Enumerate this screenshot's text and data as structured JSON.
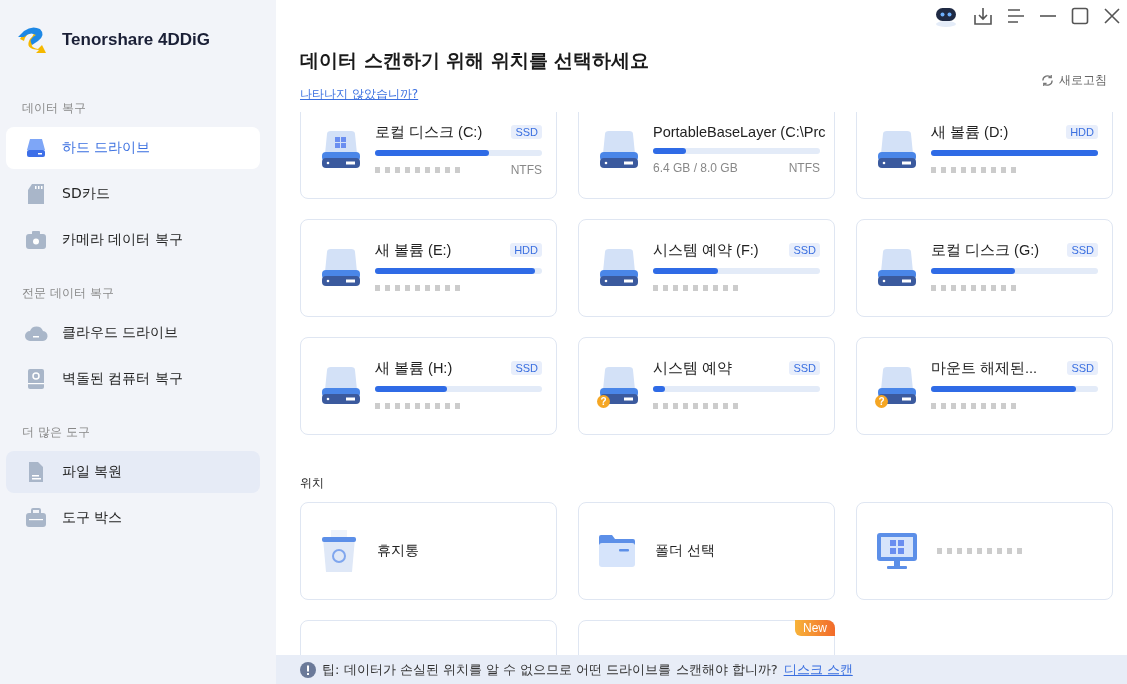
{
  "app": {
    "name": "Tenorshare 4DDiG"
  },
  "sidebar": {
    "sections": [
      {
        "title": "데이터 복구",
        "items": [
          {
            "label": "하드 드라이브",
            "selected": true
          },
          {
            "label": "SD카드",
            "selected": false
          },
          {
            "label": "카메라 데이터 복구",
            "selected": false
          }
        ]
      },
      {
        "title": "전문 데이터 복구",
        "items": [
          {
            "label": "클라우드 드라이브",
            "selected": false
          },
          {
            "label": "벽돌된 컴퓨터 복구",
            "selected": false
          }
        ]
      },
      {
        "title": "더 많은 도구",
        "items": [
          {
            "label": "파일 복원",
            "selected": false,
            "hovered": true
          },
          {
            "label": "도구 박스",
            "selected": false
          }
        ]
      }
    ]
  },
  "header": {
    "title": "데이터 스캔하기 위해 위치를 선택하세요",
    "help_link": "나타나지 않았습니까?",
    "refresh": "새로고침"
  },
  "drives": [
    {
      "name": "로컬 디스크 (C:)",
      "type": "SSD",
      "level": 0.68,
      "filesystem": "NTFS",
      "windows": true
    },
    {
      "name": "PortableBaseLayer (C:\\Prc",
      "level": 0.2,
      "usage": "6.4 GB / 8.0 GB",
      "filesystem": "NTFS",
      "windows": false
    },
    {
      "name": "새 볼륨 (D:)",
      "type": "HDD",
      "level": 1.0,
      "windows": false
    },
    {
      "name": "새 볼륨 (E:)",
      "type": "HDD",
      "level": 0.96,
      "windows": false
    },
    {
      "name": "시스템 예약 (F:)",
      "type": "SSD",
      "level": 0.39,
      "windows": false
    },
    {
      "name": "로컬 디스크 (G:)",
      "type": "SSD",
      "level": 0.5,
      "windows": false
    },
    {
      "name": "새 볼륨 (H:)",
      "type": "SSD",
      "level": 0.43,
      "windows": false
    },
    {
      "name": "시스템 예약",
      "type": "SSD",
      "level": 0.07,
      "windows": false,
      "status_mark": "?"
    },
    {
      "name": "마운트 해제된...",
      "type": "SSD",
      "level": 0.87,
      "windows": false,
      "status_mark": "?"
    }
  ],
  "locations_title": "위치",
  "locations": [
    {
      "kind": "recycle",
      "label": "휴지통"
    },
    {
      "kind": "folder",
      "label": "폴더 선택"
    },
    {
      "kind": "computer"
    },
    {
      "kind": "blank"
    },
    {
      "kind": "blank",
      "badge": "New"
    }
  ],
  "tip": {
    "text": "팁: 데이터가 손실된 위치를 알 수 없으므로 어떤 드라이브를 스캔해야 합니까?",
    "link": "디스크 스캔"
  }
}
